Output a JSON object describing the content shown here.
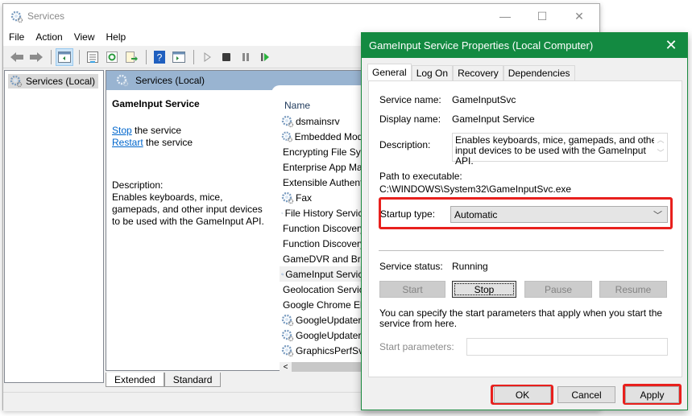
{
  "services_window": {
    "title": "Services",
    "controls": {
      "minimize": "—",
      "maximize": "☐",
      "close": "✕"
    },
    "menu": [
      "File",
      "Action",
      "View",
      "Help"
    ],
    "toolbar_icons": [
      "back-icon",
      "forward-icon",
      "show-hide-console-tree-icon",
      "properties-icon",
      "refresh-icon",
      "export-list-icon",
      "help-icon",
      "show-action-pane-icon",
      "start-service-icon",
      "stop-service-icon",
      "pause-service-icon",
      "restart-service-icon"
    ],
    "tree": {
      "root": "Services (Local)"
    },
    "pane_header": "Services (Local)",
    "detail": {
      "service_name": "GameInput Service",
      "stop_link": "Stop",
      "stop_suffix": " the service",
      "restart_link": "Restart",
      "restart_suffix": " the service",
      "description_label": "Description:",
      "description": "Enables keyboards, mice, gamepads, and other input devices to be used with the GameInput API."
    },
    "list": {
      "column_name": "Name",
      "rows": [
        "dsmainsrv",
        "Embedded Mode",
        "Encrypting File System",
        "Enterprise App Management",
        "Extensible Authentication",
        "Fax",
        "File History Service",
        "Function Discovery Provider",
        "Function Discovery Resource",
        "GameDVR and Broadcast",
        "GameInput Service",
        "Geolocation Service",
        "Google Chrome Elevation",
        "GoogleUpdater",
        "GoogleUpdater",
        "GraphicsPerfSvc"
      ],
      "selected_index": 10,
      "scroll_left_arrow": "<"
    },
    "view_tabs": [
      "Extended",
      "Standard"
    ],
    "active_view_tab": "Extended"
  },
  "properties_dialog": {
    "title": "GameInput Service Properties (Local Computer)",
    "close": "✕",
    "tabs": [
      "General",
      "Log On",
      "Recovery",
      "Dependencies"
    ],
    "active_tab": "General",
    "service_name_label": "Service name:",
    "service_name": "GameInputSvc",
    "display_name_label": "Display name:",
    "display_name": "GameInput Service",
    "description_label": "Description:",
    "description": "Enables keyboards, mice, gamepads, and other input devices to be used with the GameInput API.",
    "path_label": "Path to executable:",
    "path": "C:\\WINDOWS\\System32\\GameInputSvc.exe",
    "startup_type_label": "Startup type:",
    "startup_type_value": "Automatic",
    "status_label": "Service status:",
    "status_value": "Running",
    "buttons": {
      "start": "Start",
      "stop": "Stop",
      "pause": "Pause",
      "resume": "Resume"
    },
    "params_hint": "You can specify the start parameters that apply when you start the service from here.",
    "start_params_label": "Start parameters:",
    "start_params_value": "",
    "footer": {
      "ok": "OK",
      "cancel": "Cancel",
      "apply": "Apply"
    },
    "highlight_color": "#e8201d",
    "titlebar_color": "#138a41"
  }
}
